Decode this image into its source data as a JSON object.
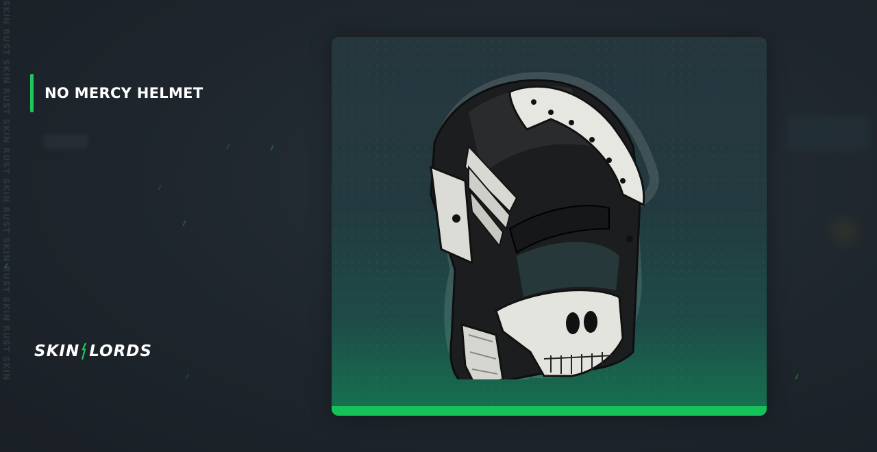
{
  "watermark": {
    "text": "SKIN RUST SKIN RUST SKIN RUST SKIN RUST SKIN RUST SKIN RUST SKIN"
  },
  "item": {
    "name": "NO MERCY HELMET",
    "image": "no-mercy-helmet-icon",
    "rarity_color": "#16c15a"
  },
  "brand": {
    "part1": "SKIN",
    "part2": "LORDS",
    "accent": "#1ec85a"
  },
  "colors": {
    "accent": "#1ec85a",
    "background": "#1e252c"
  }
}
